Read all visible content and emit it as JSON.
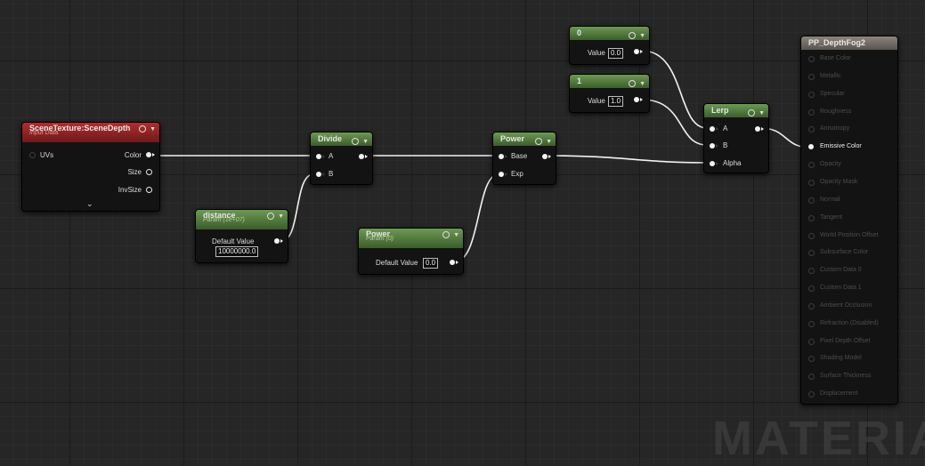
{
  "nodes": {
    "scene_texture": {
      "title": "SceneTexture:SceneDepth",
      "subtitle": "Input Data",
      "input_uvs": "UVs",
      "out_color": "Color",
      "out_size": "Size",
      "out_invsize": "InvSize"
    },
    "distance": {
      "title": "distance",
      "subtitle": "Param (1e+07)",
      "label": "Default Value",
      "value": "10000000.0"
    },
    "divide": {
      "title": "Divide",
      "pin_a": "A",
      "pin_b": "B"
    },
    "power_param": {
      "title": "Power",
      "subtitle": "Param (0)",
      "label": "Default Value",
      "value": "0.0"
    },
    "power_op": {
      "title": "Power",
      "pin_base": "Base",
      "pin_exp": "Exp"
    },
    "const_0": {
      "title": "0",
      "label": "Value",
      "value": "0.0"
    },
    "const_1": {
      "title": "1",
      "label": "Value",
      "value": "1.0"
    },
    "lerp": {
      "title": "Lerp",
      "pin_a": "A",
      "pin_b": "B",
      "pin_alpha": "Alpha"
    },
    "output": {
      "title": "PP_DepthFog2",
      "pins": [
        "Base Color",
        "Metallic",
        "Specular",
        "Roughness",
        "Anisotropy",
        "Emissive Color",
        "Opacity",
        "Opacity Mask",
        "Normal",
        "Tangent",
        "World Position Offset",
        "Subsurface Color",
        "Custom Data 0",
        "Custom Data 1",
        "Ambient Occlusion",
        "Refraction (Disabled)",
        "Pixel Depth Offset",
        "Shading Model",
        "Surface Thickness",
        "Displacement"
      ],
      "active_pin": "Emissive Color"
    }
  },
  "watermark": "MATERIAL",
  "colors": {
    "background": "#262626",
    "param_header": "#5a8a44",
    "input_header": "#9c2424",
    "result_header": "#7a736c",
    "wire": "#f2f2f2"
  },
  "icons": {
    "header_preview": "circle-arrow-icon",
    "header_collapse": "chevron-down-icon"
  }
}
